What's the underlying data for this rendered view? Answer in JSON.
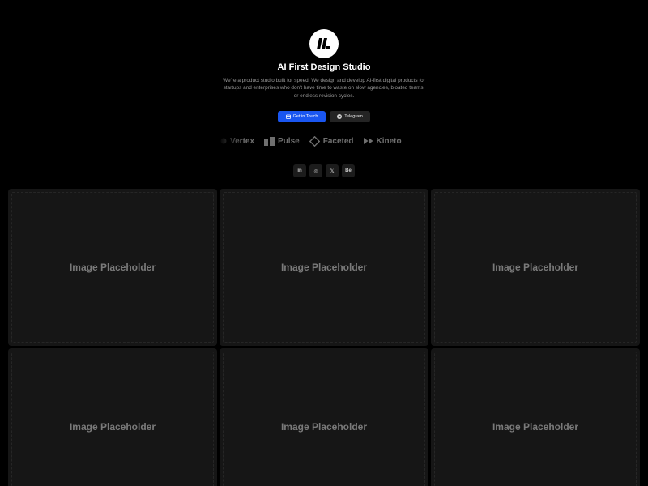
{
  "header": {
    "logo_icon": "studio-logo-icon",
    "title": "AI First Design Studio",
    "description": "We're a product studio built for speed. We design and develop AI-first digital products for startups and enterprises who don't have time to waste on slow agencies, bloated teams, or endless revision cycles."
  },
  "cta": {
    "primary_label": "Get in Touch",
    "primary_icon": "calendar-icon",
    "secondary_label": "Telegram",
    "secondary_icon": "telegram-icon",
    "accent_color": "#1a56f0"
  },
  "brands": [
    {
      "name": "Vertex",
      "icon": "dot-icon"
    },
    {
      "name": "Pulse",
      "icon": "bars-icon"
    },
    {
      "name": "Faceted",
      "icon": "diamond-icon"
    },
    {
      "name": "Kineto",
      "icon": "fast-forward-icon"
    }
  ],
  "socials": [
    {
      "name": "linkedin",
      "glyph": "in"
    },
    {
      "name": "dribbble",
      "glyph": "◎"
    },
    {
      "name": "x",
      "glyph": "𝕏"
    },
    {
      "name": "behance",
      "glyph": "Bē"
    }
  ],
  "gallery": [
    {
      "label": "Image Placeholder"
    },
    {
      "label": "Image Placeholder"
    },
    {
      "label": "Image Placeholder"
    },
    {
      "label": "Image Placeholder"
    },
    {
      "label": "Image Placeholder"
    },
    {
      "label": "Image Placeholder"
    }
  ]
}
